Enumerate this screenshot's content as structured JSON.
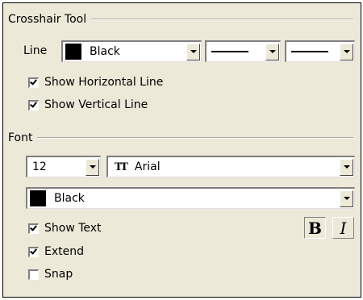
{
  "crosshair": {
    "group_title": "Crosshair Tool",
    "line_label": "Line",
    "line_color": {
      "value": "Black",
      "swatch": "#000000"
    },
    "show_horizontal": {
      "label": "Show Horizontal Line",
      "checked": true
    },
    "show_vertical": {
      "label": "Show Vertical Line",
      "checked": true
    }
  },
  "font": {
    "group_title": "Font",
    "size": "12",
    "family": "Arial",
    "family_icon": "truetype-font-icon",
    "color": {
      "value": "Black",
      "swatch": "#000000"
    },
    "show_text": {
      "label": "Show Text",
      "checked": true
    },
    "extend": {
      "label": "Extend",
      "checked": true
    },
    "snap": {
      "label": "Snap",
      "checked": false
    },
    "bold_label": "B",
    "italic_label": "I",
    "bold_active": true
  }
}
